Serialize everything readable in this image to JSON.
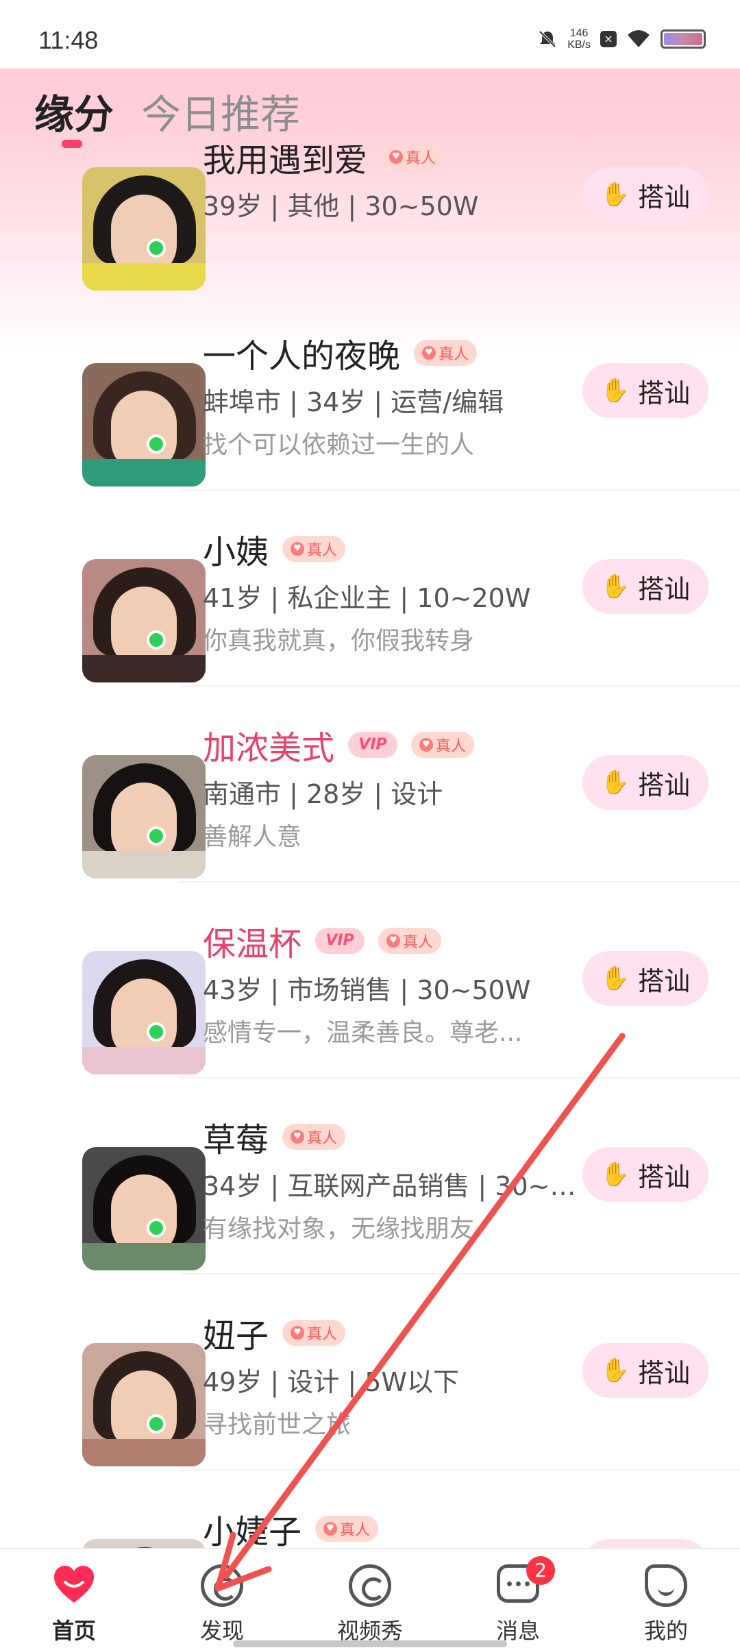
{
  "status_bar": {
    "time": "11:48",
    "net_speed_value": "146",
    "net_speed_unit": "KB/s",
    "icons": [
      "mute-bell-icon",
      "data-saver-icon",
      "wifi-icon",
      "battery-icon"
    ]
  },
  "header": {
    "tabs": [
      {
        "label": "缘分",
        "active": true
      },
      {
        "label": "今日推荐",
        "active": false
      }
    ]
  },
  "chat_button_label": "搭讪",
  "badges": {
    "real": "真人",
    "vip": "VIP"
  },
  "profiles": [
    {
      "name": "我用遇到爱",
      "vip": false,
      "real": true,
      "info": "39岁 | 其他 | 30~50W",
      "motto": "",
      "online": true
    },
    {
      "name": "一个人的夜晚",
      "vip": false,
      "real": true,
      "info": "蚌埠市 | 34岁 | 运营/编辑",
      "motto": "找个可以依赖过一生的人",
      "online": true
    },
    {
      "name": "小姨",
      "vip": false,
      "real": true,
      "info": "41岁 | 私企业主 | 10~20W",
      "motto": "你真我就真，你假我转身",
      "online": true
    },
    {
      "name": "加浓美式",
      "vip": true,
      "real": true,
      "info": "南通市 | 28岁 | 设计",
      "motto": "善解人意",
      "online": true
    },
    {
      "name": "保温杯",
      "vip": true,
      "real": true,
      "info": "43岁 | 市场销售 | 30~50W",
      "motto": "感情专一，温柔善良。尊老...",
      "online": true
    },
    {
      "name": "草莓",
      "vip": false,
      "real": true,
      "info": "34岁 | 互联网产品销售 | 30~5...",
      "motto": "有缘找对象，无缘找朋友",
      "online": true
    },
    {
      "name": "妞子",
      "vip": false,
      "real": true,
      "info": "49岁 | 设计 | 5W以下",
      "motto": "寻找前世之旅",
      "online": true
    },
    {
      "name": "小婕子",
      "vip": false,
      "real": true,
      "info": "",
      "motto": "",
      "online": false
    }
  ],
  "bottom_nav": [
    {
      "label": "首页",
      "icon": "heart-icon",
      "active": true
    },
    {
      "label": "发现",
      "icon": "discover-icon",
      "active": false
    },
    {
      "label": "视频秀",
      "icon": "video-show-icon",
      "active": false
    },
    {
      "label": "消息",
      "icon": "message-icon",
      "active": false,
      "badge": "2"
    },
    {
      "label": "我的",
      "icon": "profile-icon",
      "active": false
    }
  ],
  "colors": {
    "accent": "#ff3d6a",
    "vip_name": "#e8426b",
    "online": "#2fd05a",
    "annotation_arrow": "#f0524f"
  }
}
